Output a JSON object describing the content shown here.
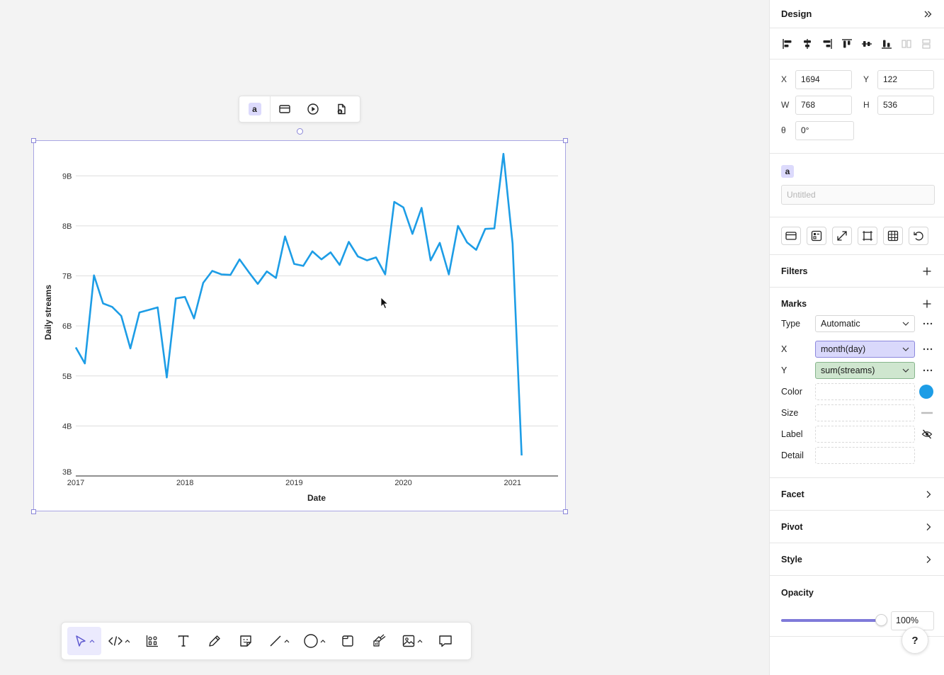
{
  "chart_toolbar": {
    "badge": "a"
  },
  "chart_data": {
    "type": "line",
    "xlabel": "Date",
    "ylabel": "Daily streams",
    "x_ticks": [
      "2017",
      "2018",
      "2019",
      "2020",
      "2021"
    ],
    "y_ticks": [
      "3B",
      "4B",
      "5B",
      "6B",
      "7B",
      "8B",
      "9B"
    ],
    "ylim": [
      3,
      9.5
    ],
    "xlim": [
      "2017-01",
      "2021-06"
    ],
    "grid": "horizontal",
    "color": "#1d9de6",
    "series": [
      {
        "x": [
          "2017-01",
          "2017-02",
          "2017-03",
          "2017-04",
          "2017-05",
          "2017-06",
          "2017-07",
          "2017-08",
          "2017-09",
          "2017-10",
          "2017-11",
          "2017-12",
          "2018-01",
          "2018-02",
          "2018-03",
          "2018-04",
          "2018-05",
          "2018-06",
          "2018-07",
          "2018-08",
          "2018-09",
          "2018-10",
          "2018-11",
          "2018-12",
          "2019-01",
          "2019-02",
          "2019-03",
          "2019-04",
          "2019-05",
          "2019-06",
          "2019-07",
          "2019-08",
          "2019-09",
          "2019-10",
          "2019-11",
          "2019-12",
          "2020-01",
          "2020-02",
          "2020-03",
          "2020-04",
          "2020-05",
          "2020-06",
          "2020-07",
          "2020-08",
          "2020-09",
          "2020-10",
          "2020-11",
          "2020-12",
          "2021-01",
          "2021-02"
        ],
        "values": [
          5.57,
          5.25,
          7.01,
          6.45,
          6.38,
          6.2,
          5.55,
          6.27,
          6.32,
          6.37,
          4.97,
          6.55,
          6.58,
          6.15,
          6.86,
          7.1,
          7.03,
          7.02,
          7.33,
          7.08,
          6.84,
          7.09,
          6.96,
          7.79,
          7.24,
          7.2,
          7.49,
          7.33,
          7.47,
          7.22,
          7.68,
          7.39,
          7.31,
          7.37,
          7.03,
          8.48,
          8.37,
          7.84,
          8.36,
          7.31,
          7.66,
          7.03,
          8.0,
          7.67,
          7.52,
          7.94,
          7.95,
          9.44,
          7.65,
          3.41
        ]
      }
    ]
  },
  "bottom_toolbar": {
    "tools": [
      "select",
      "code",
      "chart",
      "text",
      "pencil",
      "sticky-note",
      "line",
      "ellipse",
      "frame",
      "brush",
      "image",
      "comment"
    ]
  },
  "panel": {
    "title": "Design",
    "geometry": {
      "x_label": "X",
      "x_value": "1694",
      "y_label": "Y",
      "y_value": "122",
      "w_label": "W",
      "w_value": "768",
      "h_label": "H",
      "h_value": "536",
      "rot_label": "θ",
      "rot_value": "0°"
    },
    "name": {
      "badge": "a",
      "placeholder": "Untitled"
    },
    "filters": {
      "title": "Filters"
    },
    "marks": {
      "title": "Marks",
      "type_label": "Type",
      "type_value": "Automatic",
      "x_label": "X",
      "x_value": "month(day)",
      "y_label": "Y",
      "y_value": "sum(streams)",
      "color_label": "Color",
      "color_value": "#1d9de6",
      "size_label": "Size",
      "label_label": "Label",
      "detail_label": "Detail"
    },
    "facet": {
      "title": "Facet"
    },
    "pivot": {
      "title": "Pivot"
    },
    "style": {
      "title": "Style"
    },
    "opacity": {
      "title": "Opacity",
      "value": "100%",
      "fraction": 1.0
    },
    "help_label": "?"
  }
}
